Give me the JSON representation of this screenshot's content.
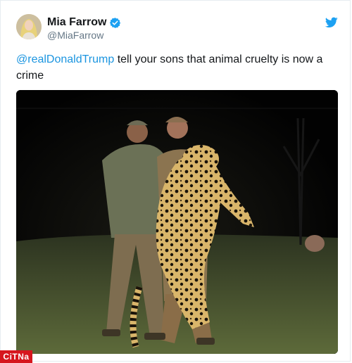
{
  "tweet": {
    "author": {
      "display_name": "Mia Farrow",
      "handle": "@MiaFarrow",
      "verified": true
    },
    "mention": "@realDonaldTrump",
    "text": "  tell your sons  that animal cruelty is now a crime",
    "media": {
      "alt": "Two hunters kneeling behind a dead leopard held upright at night"
    }
  },
  "watermark": {
    "label": "CiTNa"
  },
  "colors": {
    "link": "#1b95e0",
    "twitter_blue": "#1da1f2",
    "verified": "#1da1f2",
    "text": "#14171a",
    "secondary": "#657786",
    "watermark_bg": "#d6161e"
  },
  "icons": {
    "brand": "twitter-bird-icon",
    "verified": "verified-badge-icon"
  }
}
